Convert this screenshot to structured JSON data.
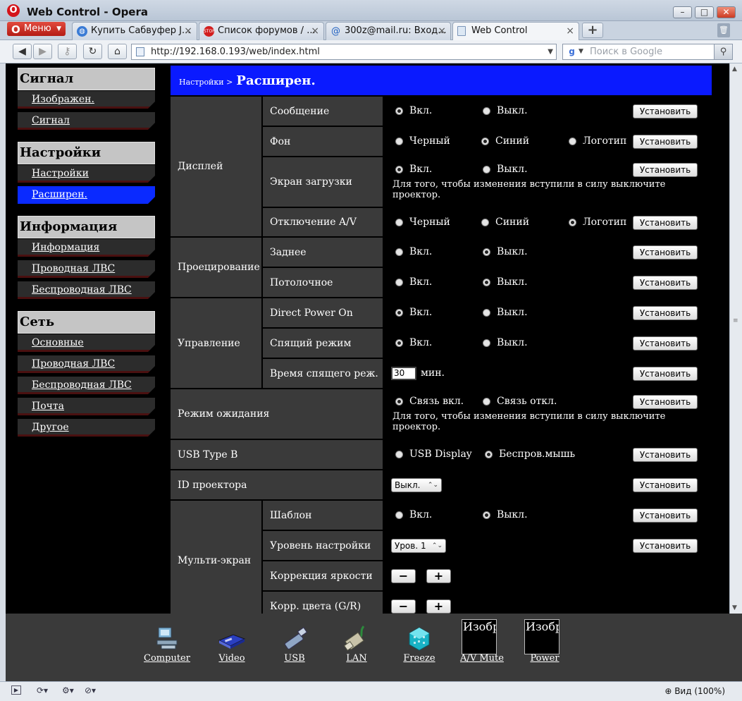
{
  "browser": {
    "window_title": "Web Control - Opera",
    "menu_label": "Меню",
    "tabs": [
      {
        "label": "Купить Сабвуфер J...",
        "icon": "globe-icon"
      },
      {
        "label": "Список форумов / ...",
        "icon": "stop-icon"
      },
      {
        "label": "300z@mail.ru: Вход...",
        "icon": "mail-icon"
      },
      {
        "label": "Web Control",
        "icon": "page-icon"
      }
    ],
    "url": "http://192.168.0.193/web/index.html",
    "search_placeholder": "Поиск в Google",
    "zoom_label": "Вид (100%)"
  },
  "sidebar": {
    "sections": [
      {
        "title": "Сигнал",
        "items": [
          "Изображен.",
          "Сигнал"
        ]
      },
      {
        "title": "Настройки",
        "items": [
          "Настройки",
          "Расширен."
        ]
      },
      {
        "title": "Информация",
        "items": [
          "Информация",
          "Проводная ЛВС",
          "Беспроводная ЛВС"
        ]
      },
      {
        "title": "Сеть",
        "items": [
          "Основные",
          "Проводная ЛВС",
          "Беспроводная ЛВС",
          "Почта",
          "Другое"
        ]
      }
    ],
    "active_item": "Расширен."
  },
  "breadcrumb": {
    "parent": "Настройки >",
    "current": "Расширен."
  },
  "set_label": "Установить",
  "groups": {
    "display": "Дисплей",
    "projection": "Проецирование",
    "control": "Управление",
    "standby": "Режим ожидания",
    "usb": "USB Type B",
    "projector_id": "ID проектора",
    "multiscreen": "Мульти-экран"
  },
  "rows": {
    "message": {
      "label": "Сообщение",
      "opt1": "Вкл.",
      "opt2": "Выкл.",
      "selected": 1
    },
    "background": {
      "label": "Фон",
      "opt1": "Черный",
      "opt2": "Синий",
      "opt3": "Логотип",
      "selected": 2
    },
    "startup": {
      "label": "Экран загрузки",
      "opt1": "Вкл.",
      "opt2": "Выкл.",
      "selected": 1,
      "note": "Для того, чтобы изменения вступили в силу выключите проектор."
    },
    "av_mute": {
      "label": "Отключение A/V",
      "opt1": "Черный",
      "opt2": "Синий",
      "opt3": "Логотип",
      "selected": 3
    },
    "rear": {
      "label": "Заднее",
      "opt1": "Вкл.",
      "opt2": "Выкл.",
      "selected": 2
    },
    "ceiling": {
      "label": "Потолочное",
      "opt1": "Вкл.",
      "opt2": "Выкл.",
      "selected": 2
    },
    "direct_power": {
      "label": "Direct Power On",
      "opt1": "Вкл.",
      "opt2": "Выкл.",
      "selected": 1
    },
    "sleep": {
      "label": "Спящий режим",
      "opt1": "Вкл.",
      "opt2": "Выкл.",
      "selected": 1
    },
    "sleep_time": {
      "label": "Время спящего реж.",
      "value": "30",
      "unit": "мин."
    },
    "standby": {
      "opt1": "Связь вкл.",
      "opt2": "Связь откл.",
      "selected": 1,
      "note": "Для того, чтобы изменения вступили в силу выключите проектор."
    },
    "usb": {
      "opt1": "USB Display",
      "opt2": "Беспров.мышь",
      "selected": 2
    },
    "projector_id": {
      "value": "Выкл."
    },
    "template": {
      "label": "Шаблон",
      "opt1": "Вкл.",
      "opt2": "Выкл.",
      "selected": 2
    },
    "adjust_level": {
      "label": "Уровень настройки",
      "value": "Уров. 1"
    },
    "brightness": {
      "label": "Коррекция яркости"
    },
    "color_gr": {
      "label": "Корр. цвета (G/R)"
    }
  },
  "minus": "−",
  "plus": "+",
  "bottom_nav": [
    {
      "label": "Computer",
      "icon": "computer-icon"
    },
    {
      "label": "Video",
      "icon": "video-icon"
    },
    {
      "label": "USB",
      "icon": "usb-icon"
    },
    {
      "label": "LAN",
      "icon": "lan-icon"
    },
    {
      "label": "Freeze",
      "icon": "freeze-icon"
    },
    {
      "label": "A/V Mute",
      "icon": "av-mute-icon",
      "image_alt": "Изобр"
    },
    {
      "label": "Power",
      "icon": "power-icon",
      "image_alt": "Изобр"
    }
  ],
  "colors": {
    "header_blue": "#0a1aff",
    "sidebar_active": "#0a2aff",
    "panel_gray": "#3a3a3a"
  }
}
